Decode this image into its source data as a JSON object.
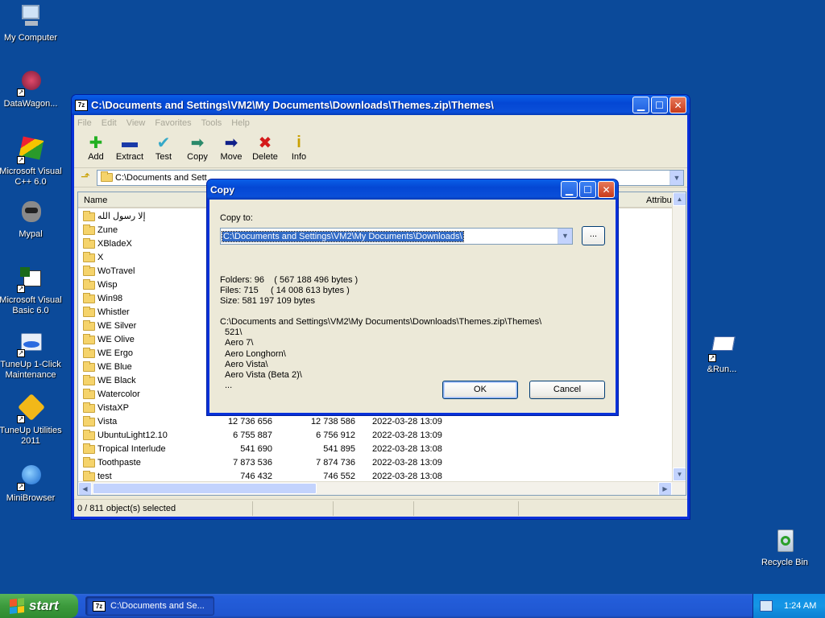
{
  "desktop": {
    "icons": [
      {
        "label": "My Computer",
        "icon": "computer-icon"
      },
      {
        "label": "DataWagon...",
        "icon": "datawagon-icon"
      },
      {
        "label": "Microsoft Visual C++ 6.0",
        "icon": "visual-cpp-icon"
      },
      {
        "label": "Mypal",
        "icon": "mypal-icon"
      },
      {
        "label": "Microsoft Visual Basic 6.0",
        "icon": "visual-basic-icon"
      },
      {
        "label": "TuneUp 1-Click Maintenance",
        "icon": "tuneup-maintenance-icon"
      },
      {
        "label": "TuneUp Utilities 2011",
        "icon": "tuneup-utilities-icon"
      },
      {
        "label": "MiniBrowser",
        "icon": "minibrowser-icon"
      },
      {
        "label": "&Run...",
        "icon": "run-icon"
      },
      {
        "label": "Recycle Bin",
        "icon": "recycle-bin-icon"
      }
    ]
  },
  "window": {
    "app_icon_text": "7z",
    "title": "C:\\Documents and Settings\\VM2\\My Documents\\Downloads\\Themes.zip\\Themes\\",
    "menu": [
      "File",
      "Edit",
      "View",
      "Favorites",
      "Tools",
      "Help"
    ],
    "toolbar": [
      {
        "label": "Add",
        "icon": "add-icon",
        "glyph": "✚",
        "color": "#22b022"
      },
      {
        "label": "Extract",
        "icon": "extract-icon",
        "glyph": "▬",
        "color": "#1a3aa8"
      },
      {
        "label": "Test",
        "icon": "test-icon",
        "glyph": "✔",
        "color": "#35a9c8"
      },
      {
        "label": "Copy",
        "icon": "copy-icon",
        "glyph": "➡",
        "color": "#2a8a6a"
      },
      {
        "label": "Move",
        "icon": "move-icon",
        "glyph": "➡",
        "color": "#10208a"
      },
      {
        "label": "Delete",
        "icon": "delete-icon",
        "glyph": "✖",
        "color": "#d41a1a"
      },
      {
        "label": "Info",
        "icon": "info-icon",
        "glyph": "i",
        "color": "#c9a000"
      }
    ],
    "address": "C:\\Documents and Sett",
    "columns": {
      "name": "Name",
      "attributes": "Attribu"
    },
    "rows": [
      {
        "name": "إلا رسول الله",
        "size": "",
        "packed": "",
        "modified": ""
      },
      {
        "name": "Zune",
        "size": "",
        "packed": "",
        "modified": ""
      },
      {
        "name": "XBladeX",
        "size": "",
        "packed": "",
        "modified": ""
      },
      {
        "name": "X",
        "size": "",
        "packed": "",
        "modified": ""
      },
      {
        "name": "WoTravel",
        "size": "",
        "packed": "",
        "modified": ""
      },
      {
        "name": "Wisp",
        "size": "",
        "packed": "",
        "modified": ""
      },
      {
        "name": "Win98",
        "size": "",
        "packed": "",
        "modified": ""
      },
      {
        "name": "Whistler",
        "size": "",
        "packed": "",
        "modified": ""
      },
      {
        "name": "WE Silver",
        "size": "",
        "packed": "",
        "modified": ""
      },
      {
        "name": "WE Olive",
        "size": "",
        "packed": "",
        "modified": ""
      },
      {
        "name": "WE Ergo",
        "size": "",
        "packed": "",
        "modified": ""
      },
      {
        "name": "WE Blue",
        "size": "",
        "packed": "",
        "modified": ""
      },
      {
        "name": "WE Black",
        "size": "",
        "packed": "",
        "modified": ""
      },
      {
        "name": "Watercolor",
        "size": "",
        "packed": "",
        "modified": ""
      },
      {
        "name": "VistaXP",
        "size": "",
        "packed": "",
        "modified": ""
      },
      {
        "name": "Vista",
        "size": "12 736 656",
        "packed": "12 738 586",
        "modified": "2022-03-28 13:09"
      },
      {
        "name": "UbuntuLight12.10",
        "size": "6 755 887",
        "packed": "6 756 912",
        "modified": "2022-03-28 13:09"
      },
      {
        "name": "Tropical Interlude",
        "size": "541 690",
        "packed": "541 895",
        "modified": "2022-03-28 13:08"
      },
      {
        "name": "Toothpaste",
        "size": "7 873 536",
        "packed": "7 874 736",
        "modified": "2022-03-28 13:09"
      },
      {
        "name": "test",
        "size": "746 432",
        "packed": "746 552",
        "modified": "2022-03-28 13:08"
      }
    ],
    "status": "0 / 811 object(s) selected"
  },
  "dialog": {
    "title": "Copy",
    "copy_to_label": "Copy to:",
    "destination": "C:\\Documents and Settings\\VM2\\My Documents\\Downloads\\",
    "browse_label": "...",
    "folders_line": "Folders: 96    ( 567 188 496 bytes )",
    "files_line": "Files: 715     ( 14 008 613 bytes )",
    "size_line": "Size: 581 197 109 bytes",
    "source_path": "C:\\Documents and Settings\\VM2\\My Documents\\Downloads\\Themes.zip\\Themes\\",
    "items": [
      "521\\",
      "Aero 7\\",
      "Aero Longhorn\\",
      "Aero Vista\\",
      "Aero Vista (Beta 2)\\",
      "..."
    ],
    "ok_label": "OK",
    "cancel_label": "Cancel"
  },
  "taskbar": {
    "start_label": "start",
    "task_label": "C:\\Documents and Se...",
    "task_icon_text": "7z",
    "clock": "1:24 AM"
  }
}
